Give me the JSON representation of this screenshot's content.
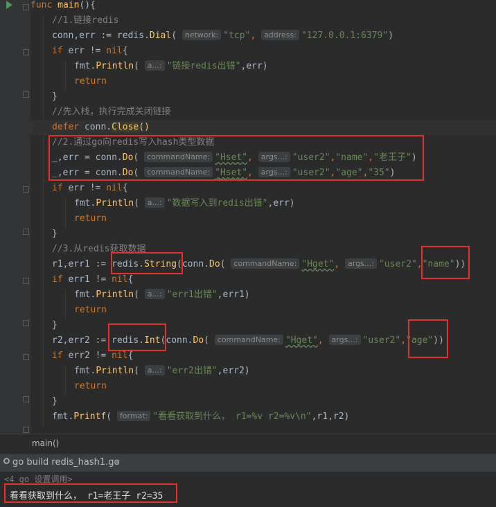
{
  "code": {
    "l0": {
      "kw": "func",
      "name": "main",
      "rest": "(){"
    },
    "l1": "//1.链接redis",
    "l2": {
      "a": "conn,err := ",
      "pkg": "redis.",
      "fn": "Dial",
      "p": "(",
      "h1": "network:",
      "s1": "\"tcp\"",
      "c": ",",
      "h2": "address:",
      "s2": "\"127.0.0.1:6379\"",
      "e": ")"
    },
    "l3": {
      "kw": "if",
      "rest": " err != ",
      "nil": "nil",
      "b": "{"
    },
    "l4": {
      "a": "fmt.",
      "fn": "Println",
      "p": "(",
      "h": "a...:",
      "s": "\"链接redis出错\"",
      "e": ",err)"
    },
    "l5": "return",
    "l6": "}",
    "l7": "//先入栈，执行完成关闭链接",
    "l8": {
      "kw": "defer",
      "a": " conn.",
      "fn": "Close",
      "e": "()"
    },
    "l9": "//2.通过go向redis写入hash类型数据",
    "l10": {
      "a": "_,err = conn.",
      "fn": "Do",
      "p": "(",
      "h1": "commandName:",
      "s1": "\"Hset\"",
      "c": ",",
      "h2": "args...:",
      "s2": "\"user2\"",
      "c2": ",",
      "s3": "\"name\"",
      "c3": ",",
      "s4": "\"老王子\"",
      "e": ")"
    },
    "l11": {
      "a": "_,err = conn.",
      "fn": "Do",
      "p": "(",
      "h1": "commandName:",
      "s1": "\"Hset\"",
      "c": ",",
      "h2": "args...:",
      "s2": "\"user2\"",
      "c2": ",",
      "s3": "\"age\"",
      "c3": ",",
      "s4": "\"35\"",
      "e": ")"
    },
    "l12": {
      "kw": "if",
      "rest": " err != ",
      "nil": "nil",
      "b": "{"
    },
    "l13": {
      "a": "fmt.",
      "fn": "Println",
      "p": "(",
      "h": "a...:",
      "s": "\"数据写入到redis出错\"",
      "e": ",err)"
    },
    "l14": "return",
    "l15": "}",
    "l16": "//3.从redis获取数据",
    "l17": {
      "a": "r1,err1 := ",
      "pkg": "redis.",
      "fn": "String",
      "m": "(conn.",
      "fn2": "Do",
      "p": "(",
      "h1": "commandName:",
      "s1": "\"Hget\"",
      "c": ",",
      "h2": "args...:",
      "s2": "\"user2\"",
      "c2": ",",
      "s3": "\"name\"",
      "e": "))"
    },
    "l18": {
      "kw": "if",
      "rest": " err1 != ",
      "nil": "nil",
      "b": "{"
    },
    "l19": {
      "a": "fmt.",
      "fn": "Println",
      "p": "(",
      "h": "a...:",
      "s": "\"err1出错\"",
      "e": ",err1)"
    },
    "l20": "return",
    "l21": "}",
    "l22": {
      "a": "r2,err2 := ",
      "pkg": "redis.",
      "fn": "Int",
      "m": "(conn.",
      "fn2": "Do",
      "p": "(",
      "h1": "commandName:",
      "s1": "\"Hget\"",
      "c": ",",
      "h2": "args...:",
      "s2": "\"user2\"",
      "c2": ",",
      "s3": "\"age\"",
      "e": "))"
    },
    "l23": {
      "kw": "if",
      "rest": " err2 != ",
      "nil": "nil",
      "b": "{"
    },
    "l24": {
      "a": "fmt.",
      "fn": "Println",
      "p": "(",
      "h": "a...:",
      "s": "\"err2出错\"",
      "e": ",err2)"
    },
    "l25": "return",
    "l26": "}",
    "l27": {
      "a": "fmt.",
      "fn": "Printf",
      "p": "(",
      "h": "format:",
      "s": "\"看看获取到什么， r1=%v r2=%v\\n\"",
      "e": ",r1,r2)"
    }
  },
  "breadcrumb": "main()",
  "run_tab": {
    "label": "go build redis_hash1.go",
    "close": "×"
  },
  "console": {
    "line1": "<4 go 设置调用>",
    "line2": "看看获取到什么， r1=老王子 r2=35"
  },
  "colors": {
    "keyword": "#cc7832",
    "function": "#ffc66d",
    "string": "#6a8759",
    "comment": "#808080",
    "annotation_box": "#e5312c"
  }
}
